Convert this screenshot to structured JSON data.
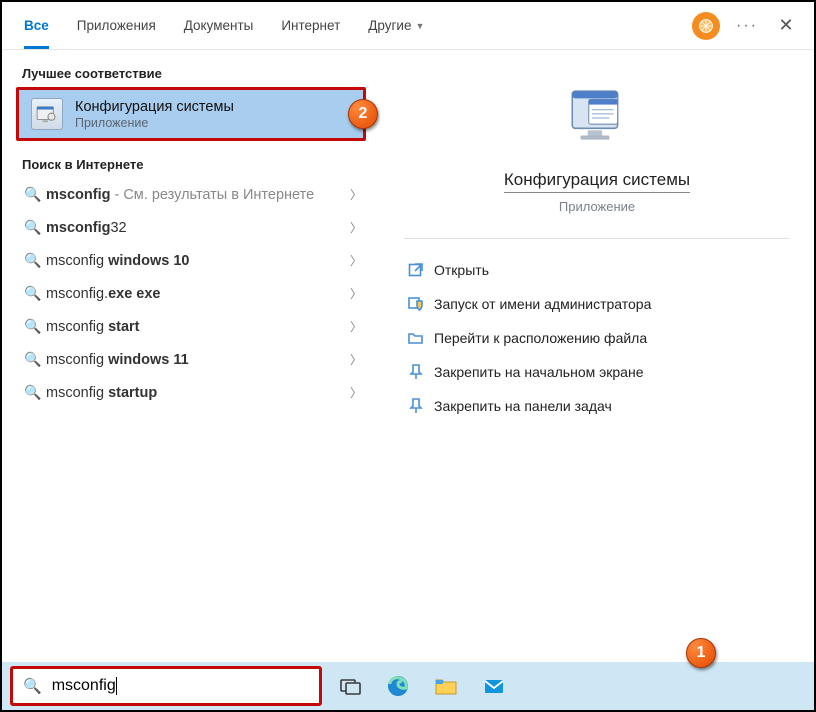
{
  "tabs": {
    "all": "Все",
    "apps": "Приложения",
    "docs": "Документы",
    "web": "Интернет",
    "more": "Другие"
  },
  "left": {
    "header_best": "Лучшее соответствие",
    "best_match": {
      "title": "Конфигурация системы",
      "subtitle": "Приложение"
    },
    "header_web": "Поиск в Интернете",
    "results": [
      {
        "bold": "msconfig",
        "rest": " - См. результаты в Интернете"
      },
      {
        "bold": "msconfig",
        "rest": "32"
      },
      {
        "bold": "msconfig ",
        "rest": "windows 10",
        "restBold": true
      },
      {
        "bold": "msconfig",
        "rest": ".exe exe",
        "restBold": true,
        "mixed": "exe"
      },
      {
        "bold": "msconfig ",
        "rest": "start",
        "restBold": true
      },
      {
        "bold": "msconfig ",
        "rest": "windows 11",
        "restBold": true
      },
      {
        "bold": "msconfig ",
        "rest": "startup",
        "restBold": true
      }
    ]
  },
  "right": {
    "title": "Конфигурация системы",
    "subtitle": "Приложение",
    "actions": {
      "open": "Открыть",
      "admin": "Запуск от имени администратора",
      "folder": "Перейти к расположению файла",
      "pin_start": "Закрепить на начальном экране",
      "pin_task": "Закрепить на панели задач"
    }
  },
  "search": {
    "query": "msconfig"
  },
  "callouts": {
    "one": "1",
    "two": "2"
  }
}
